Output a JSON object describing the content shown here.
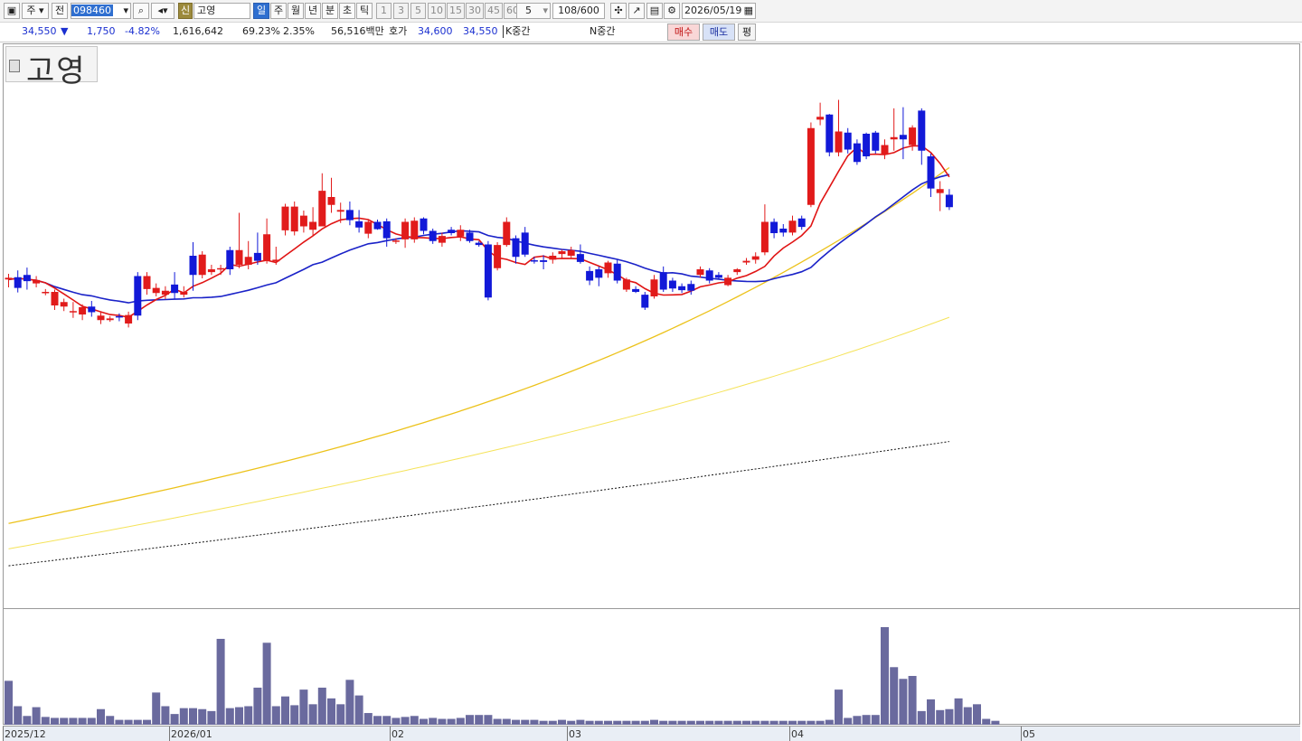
{
  "toolbar": {
    "period_label": "주",
    "all_label": "전",
    "stock_code": "098460",
    "sin_label": "신",
    "stock_name": "고영",
    "periods": [
      "일",
      "주",
      "월",
      "년",
      "분",
      "초",
      "틱"
    ],
    "numbers": [
      "1",
      "3",
      "5",
      "10",
      "15",
      "30",
      "45",
      "60"
    ],
    "interval_value": "5",
    "count": "108/600",
    "date": "2026/05/19"
  },
  "quote": {
    "price": "34,550",
    "change_arrow": "▼",
    "change": "1,750",
    "change_pct": "-4.82%",
    "volume": "1,616,642",
    "vol_ratio": "69.23%",
    "turnover": "2.35%",
    "amount": "56,516백만",
    "hoga_label": "호가",
    "ask": "34,600",
    "bid": "34,550",
    "k_label": "K중간",
    "n_label": "N중간",
    "buy_label": "매수",
    "sell_label": "매도",
    "pyeong_label": "평"
  },
  "chart_title": "고영",
  "x_axis_labels": [
    "2025/12",
    "2026/01",
    "02",
    "03",
    "04",
    "05"
  ],
  "colors": {
    "up": "#e11b1b",
    "down": "#1219d8",
    "ma5": "#e01414",
    "ma20": "#1a22c8",
    "ma60": "#ecc21a",
    "ma120": "#f5e35a",
    "ma240": "#111111",
    "volume": "#6a6a9e"
  },
  "chart_data": {
    "type": "candlestick",
    "candles": [
      [
        1,
        0.415,
        0.418,
        0.408,
        0.432
      ],
      [
        0,
        0.433,
        0.414,
        0.402,
        0.441
      ],
      [
        0,
        0.41,
        0.421,
        0.397,
        0.436
      ],
      [
        1,
        0.419,
        0.425,
        0.412,
        0.432
      ],
      [
        1,
        0.44,
        0.442,
        0.435,
        0.446
      ],
      [
        1,
        0.44,
        0.464,
        0.436,
        0.472
      ],
      [
        1,
        0.458,
        0.466,
        0.452,
        0.474
      ],
      [
        1,
        0.474,
        0.475,
        0.458,
        0.486
      ],
      [
        1,
        0.467,
        0.48,
        0.462,
        0.49
      ],
      [
        0,
        0.476,
        0.466,
        0.456,
        0.484
      ],
      [
        1,
        0.482,
        0.49,
        0.475,
        0.497
      ],
      [
        1,
        0.487,
        0.49,
        0.483,
        0.493
      ],
      [
        0,
        0.485,
        0.483,
        0.478,
        0.492
      ],
      [
        1,
        0.481,
        0.496,
        0.475,
        0.503
      ],
      [
        0,
        0.482,
        0.412,
        0.405,
        0.49
      ],
      [
        1,
        0.412,
        0.435,
        0.405,
        0.445
      ],
      [
        1,
        0.433,
        0.442,
        0.425,
        0.448
      ],
      [
        1,
        0.438,
        0.445,
        0.43,
        0.453
      ],
      [
        0,
        0.427,
        0.442,
        0.405,
        0.452
      ],
      [
        1,
        0.44,
        0.445,
        0.43,
        0.45
      ],
      [
        0,
        0.41,
        0.376,
        0.352,
        0.438
      ],
      [
        1,
        0.374,
        0.41,
        0.368,
        0.416
      ],
      [
        1,
        0.4,
        0.405,
        0.392,
        0.41
      ],
      [
        1,
        0.398,
        0.4,
        0.392,
        0.41
      ],
      [
        0,
        0.4,
        0.366,
        0.36,
        0.41
      ],
      [
        1,
        0.366,
        0.392,
        0.3,
        0.398
      ],
      [
        1,
        0.378,
        0.392,
        0.35,
        0.4
      ],
      [
        0,
        0.371,
        0.385,
        0.335,
        0.392
      ],
      [
        1,
        0.338,
        0.385,
        0.31,
        0.39
      ],
      [
        1,
        0.383,
        0.386,
        0.36,
        0.392
      ],
      [
        1,
        0.289,
        0.331,
        0.284,
        0.34
      ],
      [
        1,
        0.289,
        0.333,
        0.28,
        0.34
      ],
      [
        1,
        0.305,
        0.324,
        0.296,
        0.335
      ],
      [
        1,
        0.316,
        0.33,
        0.29,
        0.34
      ],
      [
        1,
        0.261,
        0.324,
        0.23,
        0.32
      ],
      [
        1,
        0.272,
        0.286,
        0.238,
        0.3
      ],
      [
        1,
        0.295,
        0.298,
        0.282,
        0.318
      ],
      [
        0,
        0.295,
        0.313,
        0.28,
        0.322
      ],
      [
        0,
        0.315,
        0.326,
        0.295,
        0.335
      ],
      [
        1,
        0.316,
        0.337,
        0.312,
        0.345
      ],
      [
        0,
        0.316,
        0.329,
        0.312,
        0.33
      ],
      [
        0,
        0.315,
        0.345,
        0.31,
        0.36
      ],
      [
        1,
        0.349,
        0.35,
        0.345,
        0.355
      ],
      [
        1,
        0.316,
        0.347,
        0.31,
        0.362
      ],
      [
        1,
        0.314,
        0.347,
        0.308,
        0.353
      ],
      [
        0,
        0.31,
        0.332,
        0.308,
        0.338
      ],
      [
        0,
        0.332,
        0.35,
        0.328,
        0.355
      ],
      [
        1,
        0.341,
        0.353,
        0.335,
        0.36
      ],
      [
        0,
        0.33,
        0.336,
        0.325,
        0.34
      ],
      [
        1,
        0.33,
        0.342,
        0.322,
        0.35
      ],
      [
        0,
        0.335,
        0.35,
        0.33,
        0.353
      ],
      [
        0,
        0.353,
        0.357,
        0.35,
        0.36
      ],
      [
        0,
        0.356,
        0.45,
        0.35,
        0.455
      ],
      [
        1,
        0.357,
        0.398,
        0.352,
        0.402
      ],
      [
        1,
        0.316,
        0.357,
        0.308,
        0.36
      ],
      [
        0,
        0.345,
        0.378,
        0.34,
        0.39
      ],
      [
        0,
        0.335,
        0.374,
        0.325,
        0.378
      ],
      [
        0,
        0.384,
        0.386,
        0.378,
        0.39
      ],
      [
        0,
        0.384,
        0.387,
        0.375,
        0.4
      ],
      [
        1,
        0.376,
        0.383,
        0.37,
        0.39
      ],
      [
        1,
        0.368,
        0.373,
        0.365,
        0.38
      ],
      [
        1,
        0.366,
        0.376,
        0.36,
        0.38
      ],
      [
        0,
        0.373,
        0.387,
        0.356,
        0.39
      ],
      [
        0,
        0.403,
        0.42,
        0.395,
        0.428
      ],
      [
        0,
        0.4,
        0.415,
        0.395,
        0.43
      ],
      [
        1,
        0.388,
        0.407,
        0.385,
        0.415
      ],
      [
        0,
        0.39,
        0.42,
        0.383,
        0.425
      ],
      [
        1,
        0.418,
        0.436,
        0.415,
        0.44
      ],
      [
        0,
        0.435,
        0.44,
        0.43,
        0.442
      ],
      [
        0,
        0.445,
        0.468,
        0.44,
        0.472
      ],
      [
        1,
        0.418,
        0.448,
        0.41,
        0.452
      ],
      [
        0,
        0.405,
        0.436,
        0.395,
        0.44
      ],
      [
        0,
        0.42,
        0.434,
        0.415,
        0.44
      ],
      [
        0,
        0.43,
        0.437,
        0.425,
        0.442
      ],
      [
        0,
        0.426,
        0.438,
        0.42,
        0.445
      ],
      [
        1,
        0.4,
        0.41,
        0.395,
        0.415
      ],
      [
        0,
        0.402,
        0.42,
        0.398,
        0.425
      ],
      [
        0,
        0.41,
        0.415,
        0.405,
        0.418
      ],
      [
        1,
        0.415,
        0.428,
        0.41,
        0.43
      ],
      [
        1,
        0.4,
        0.405,
        0.398,
        0.41
      ],
      [
        1,
        0.385,
        0.388,
        0.38,
        0.392
      ],
      [
        1,
        0.377,
        0.383,
        0.37,
        0.39
      ],
      [
        1,
        0.316,
        0.37,
        0.285,
        0.375
      ],
      [
        0,
        0.316,
        0.336,
        0.31,
        0.345
      ],
      [
        0,
        0.328,
        0.335,
        0.32,
        0.342
      ],
      [
        1,
        0.314,
        0.335,
        0.305,
        0.34
      ],
      [
        0,
        0.31,
        0.325,
        0.305,
        0.33
      ],
      [
        1,
        0.15,
        0.286,
        0.14,
        0.29
      ],
      [
        1,
        0.13,
        0.135,
        0.105,
        0.145
      ],
      [
        0,
        0.126,
        0.193,
        0.125,
        0.2
      ],
      [
        1,
        0.156,
        0.193,
        0.1,
        0.2
      ],
      [
        0,
        0.158,
        0.188,
        0.15,
        0.195
      ],
      [
        0,
        0.177,
        0.21,
        0.17,
        0.215
      ],
      [
        0,
        0.16,
        0.2,
        0.158,
        0.205
      ],
      [
        0,
        0.158,
        0.19,
        0.155,
        0.195
      ],
      [
        1,
        0.18,
        0.197,
        0.17,
        0.205
      ],
      [
        1,
        0.166,
        0.17,
        0.115,
        0.19
      ],
      [
        0,
        0.162,
        0.17,
        0.113,
        0.205
      ],
      [
        1,
        0.149,
        0.18,
        0.145,
        0.19
      ],
      [
        0,
        0.119,
        0.19,
        0.115,
        0.215
      ],
      [
        0,
        0.2,
        0.257,
        0.195,
        0.272
      ],
      [
        1,
        0.258,
        0.265,
        0.244,
        0.297
      ],
      [
        0,
        0.268,
        0.29,
        0.258,
        0.295
      ]
    ],
    "volume": [
      0.45,
      0.19,
      0.09,
      0.18,
      0.08,
      0.07,
      0.07,
      0.07,
      0.07,
      0.07,
      0.16,
      0.09,
      0.05,
      0.05,
      0.05,
      0.05,
      0.33,
      0.19,
      0.11,
      0.17,
      0.17,
      0.16,
      0.14,
      0.88,
      0.17,
      0.18,
      0.19,
      0.38,
      0.84,
      0.19,
      0.29,
      0.2,
      0.36,
      0.21,
      0.38,
      0.27,
      0.21,
      0.46,
      0.3,
      0.12,
      0.09,
      0.09,
      0.07,
      0.08,
      0.09,
      0.06,
      0.07,
      0.06,
      0.06,
      0.07,
      0.1,
      0.1,
      0.1,
      0.06,
      0.06,
      0.05,
      0.05,
      0.05,
      0.04,
      0.04,
      0.05,
      0.04,
      0.05,
      0.04,
      0.04,
      0.04,
      0.04,
      0.04,
      0.04,
      0.04,
      0.05,
      0.04,
      0.04,
      0.04,
      0.04,
      0.04,
      0.04,
      0.04,
      0.04,
      0.04,
      0.04,
      0.04,
      0.04,
      0.04,
      0.04,
      0.04,
      0.04,
      0.04,
      0.04,
      0.05,
      0.36,
      0.07,
      0.09,
      0.1,
      0.1,
      1.0,
      0.59,
      0.47,
      0.5,
      0.14,
      0.26,
      0.15,
      0.16,
      0.27,
      0.18,
      0.21,
      0.06,
      0.04
    ]
  }
}
